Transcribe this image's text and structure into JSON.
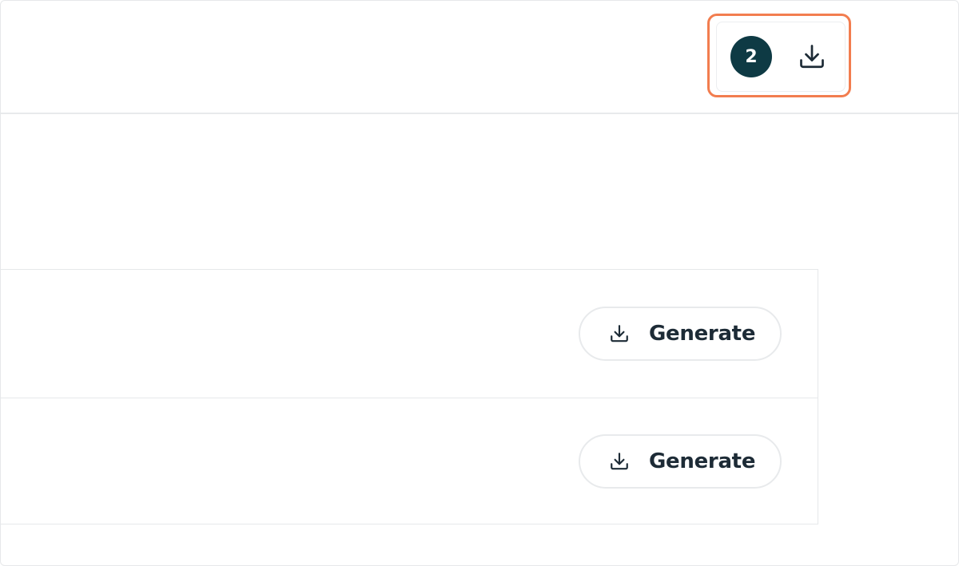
{
  "header": {
    "downloads": {
      "count": "2",
      "icon": "download-icon"
    }
  },
  "rows": [
    {
      "button_label": "Generate",
      "icon": "download-icon"
    },
    {
      "button_label": "Generate",
      "icon": "download-icon"
    }
  ],
  "colors": {
    "badge_bg": "#0e3a44",
    "highlight": "#f27d4f",
    "text": "#1d2b36"
  }
}
